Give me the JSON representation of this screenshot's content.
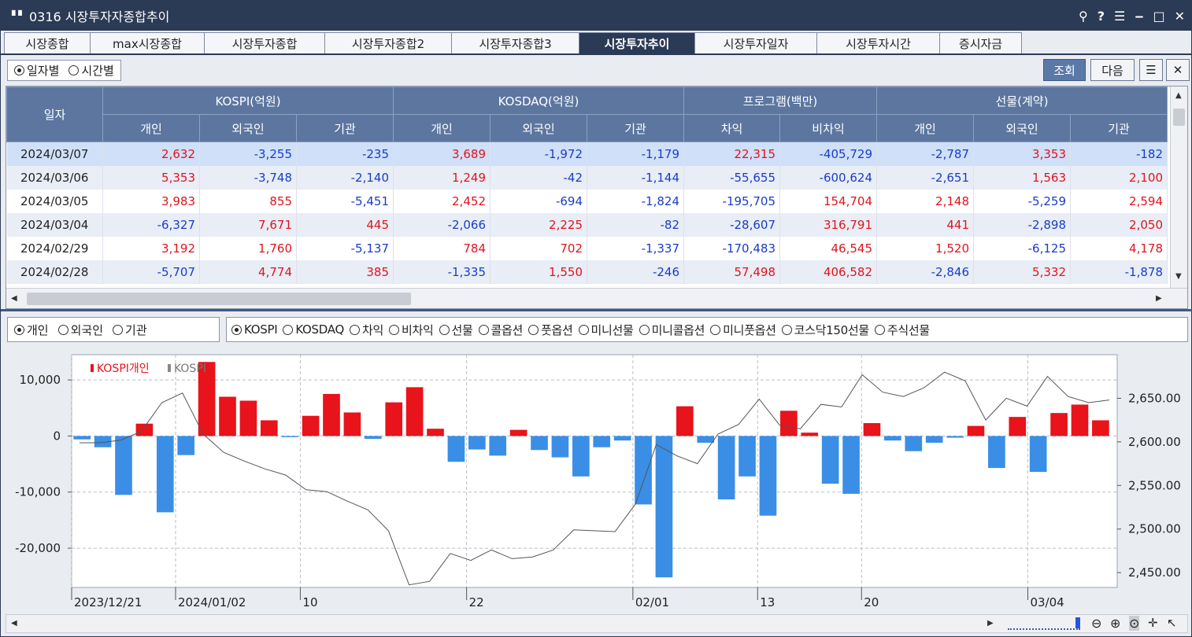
{
  "window": {
    "icon": "grid-dots-icon",
    "title": "0316 시장투자자종합추이",
    "controls": [
      "pin-icon",
      "help-icon",
      "menu-icon",
      "minimize-icon",
      "maximize-icon",
      "close-icon"
    ],
    "control_glyphs": [
      "⚲",
      "?",
      "☰",
      "‒",
      "□",
      "✕"
    ]
  },
  "tabs": [
    {
      "label": "시장종합",
      "active": false
    },
    {
      "label": "max시장종합",
      "active": false
    },
    {
      "label": "시장투자종합",
      "active": false
    },
    {
      "label": "시장투자종합2",
      "active": false
    },
    {
      "label": "시장투자종합3",
      "active": false
    },
    {
      "label": "시장투자추이",
      "active": true
    },
    {
      "label": "시장투자일자",
      "active": false
    },
    {
      "label": "시장투자시간",
      "active": false
    },
    {
      "label": "증시자금",
      "active": false
    }
  ],
  "toolbar": {
    "period_options": [
      {
        "label": "일자별",
        "checked": true
      },
      {
        "label": "시간별",
        "checked": false
      }
    ],
    "query_label": "조회",
    "next_label": "다음",
    "list_icon": "list-icon",
    "close_icon": "close-x-icon"
  },
  "table": {
    "date_header": "일자",
    "groups": [
      "KOSPI(억원)",
      "KOSDAQ(억원)",
      "프로그램(백만)",
      "선물(계약)"
    ],
    "subheaders": [
      "개인",
      "외국인",
      "기관",
      "개인",
      "외국인",
      "기관",
      "차익",
      "비차익",
      "개인",
      "외국인",
      "기관"
    ],
    "rows": [
      {
        "date": "2024/03/07",
        "values": [
          "2,632",
          "-3,255",
          "-235",
          "3,689",
          "-1,972",
          "-1,179",
          "22,315",
          "-405,729",
          "-2,787",
          "3,353",
          "-182"
        ]
      },
      {
        "date": "2024/03/06",
        "values": [
          "5,353",
          "-3,748",
          "-2,140",
          "1,249",
          "-42",
          "-1,144",
          "-55,655",
          "-600,624",
          "-2,651",
          "1,563",
          "2,100"
        ]
      },
      {
        "date": "2024/03/05",
        "values": [
          "3,983",
          "855",
          "-5,451",
          "2,452",
          "-694",
          "-1,824",
          "-195,705",
          "154,704",
          "2,148",
          "-5,259",
          "2,594"
        ]
      },
      {
        "date": "2024/03/04",
        "values": [
          "-6,327",
          "7,671",
          "445",
          "-2,066",
          "2,225",
          "-82",
          "-28,607",
          "316,791",
          "441",
          "-2,898",
          "2,050"
        ]
      },
      {
        "date": "2024/02/29",
        "values": [
          "3,192",
          "1,760",
          "-5,137",
          "784",
          "702",
          "-1,337",
          "-170,483",
          "46,545",
          "1,520",
          "-6,125",
          "4,178"
        ]
      },
      {
        "date": "2024/02/28",
        "values": [
          "-5,707",
          "4,774",
          "385",
          "-1,335",
          "1,550",
          "-246",
          "57,498",
          "406,582",
          "-2,846",
          "5,332",
          "-1,878"
        ]
      }
    ]
  },
  "investor_options": [
    {
      "label": "개인",
      "checked": true
    },
    {
      "label": "외국인",
      "checked": false
    },
    {
      "label": "기관",
      "checked": false
    }
  ],
  "market_options": [
    {
      "label": "KOSPI",
      "checked": true
    },
    {
      "label": "KOSDAQ",
      "checked": false
    },
    {
      "label": "차익",
      "checked": false
    },
    {
      "label": "비차익",
      "checked": false
    },
    {
      "label": "선물",
      "checked": false
    },
    {
      "label": "콜옵션",
      "checked": false
    },
    {
      "label": "풋옵션",
      "checked": false
    },
    {
      "label": "미니선물",
      "checked": false
    },
    {
      "label": "미니콜옵션",
      "checked": false
    },
    {
      "label": "미니풋옵션",
      "checked": false
    },
    {
      "label": "코스닥150선물",
      "checked": false
    },
    {
      "label": "주식선물",
      "checked": false
    }
  ],
  "chart_data": {
    "type": "bar",
    "title": "",
    "legend": [
      "KOSPI개인",
      "KOSPI"
    ],
    "colors": {
      "positive": "#e8131b",
      "negative": "#3a8ee6",
      "line": "#555555"
    },
    "y_left": {
      "ticks": [
        "10,000",
        "0",
        "-10,000",
        "-20,000"
      ],
      "tick_values": [
        10000,
        0,
        -10000,
        -20000
      ],
      "range": [
        -27000,
        14500
      ]
    },
    "y_right": {
      "ticks": [
        "2,650.00",
        "2,600.00",
        "2,550.00",
        "2,500.00",
        "2,450.00"
      ],
      "tick_values": [
        2650,
        2600,
        2550,
        2500,
        2450
      ],
      "range": [
        2433,
        2700
      ]
    },
    "x_labels": [
      {
        "label": "2023/12/21",
        "index": 0
      },
      {
        "label": "2024/01/02",
        "index": 5
      },
      {
        "label": "10",
        "index": 11
      },
      {
        "label": "22",
        "index": 19
      },
      {
        "label": "02/01",
        "index": 27
      },
      {
        "label": "13",
        "index": 33
      },
      {
        "label": "20",
        "index": 38
      },
      {
        "label": "03/04",
        "index": 46
      }
    ],
    "series": [
      {
        "name": "KOSPI개인",
        "values": [
          -600,
          -2000,
          -10500,
          2200,
          -13600,
          -3400,
          13200,
          7000,
          6300,
          2800,
          -200,
          3600,
          7500,
          4200,
          -500,
          6000,
          8700,
          1300,
          -4600,
          -2400,
          -3500,
          1100,
          -2500,
          -3800,
          -7200,
          -2000,
          -800,
          -12200,
          -25200,
          5300,
          -1200,
          -11300,
          -7200,
          -14200,
          4500,
          600,
          -8500,
          -10300,
          2300,
          -800,
          -2700,
          -1200,
          -300,
          1800,
          -5700,
          3400,
          -6400,
          4100,
          5600,
          2800
        ]
      },
      {
        "name": "KOSPI",
        "values": [
          2599,
          2599,
          2602,
          2612,
          2645,
          2656,
          2609,
          2588,
          2578,
          2569,
          2562,
          2545,
          2543,
          2532,
          2522,
          2498,
          2436,
          2440,
          2472,
          2464,
          2476,
          2466,
          2468,
          2476,
          2499,
          2498,
          2497,
          2529,
          2597,
          2584,
          2575,
          2609,
          2620,
          2649,
          2619,
          2615,
          2643,
          2640,
          2677,
          2657,
          2652,
          2662,
          2680,
          2670,
          2625,
          2650,
          2641,
          2675,
          2652,
          2645,
          2648
        ]
      }
    ]
  },
  "zoom_icons": [
    "zoom-out-icon",
    "zoom-in-icon",
    "zoom-fit-icon",
    "crosshair-icon",
    "pointer-icon"
  ]
}
